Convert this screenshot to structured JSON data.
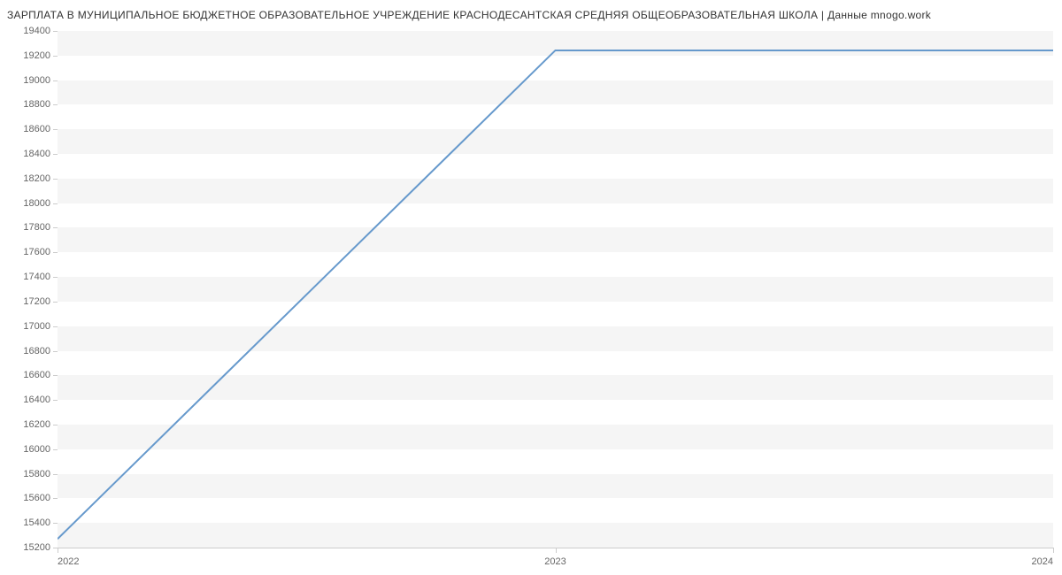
{
  "chart_data": {
    "type": "line",
    "title": "ЗАРПЛАТА В МУНИЦИПАЛЬНОЕ БЮДЖЕТНОЕ  ОБРАЗОВАТЕЛЬНОЕ УЧРЕЖДЕНИЕ КРАСНОДЕСАНТСКАЯ СРЕДНЯЯ ОБЩЕОБРАЗОВАТЕЛЬНАЯ ШКОЛА | Данные mnogo.work",
    "x": [
      2022,
      2023,
      2024
    ],
    "values": [
      15270,
      19242,
      19242
    ],
    "xlabel": "",
    "ylabel": "",
    "xlim": [
      2022,
      2024
    ],
    "ylim": [
      15200,
      19400
    ],
    "y_ticks": [
      15200,
      15400,
      15600,
      15800,
      16000,
      16200,
      16400,
      16600,
      16800,
      17000,
      17200,
      17400,
      17600,
      17800,
      18000,
      18200,
      18400,
      18600,
      18800,
      19000,
      19200,
      19400
    ],
    "x_ticks": [
      2022,
      2023,
      2024
    ],
    "line_color": "#6699cc"
  }
}
